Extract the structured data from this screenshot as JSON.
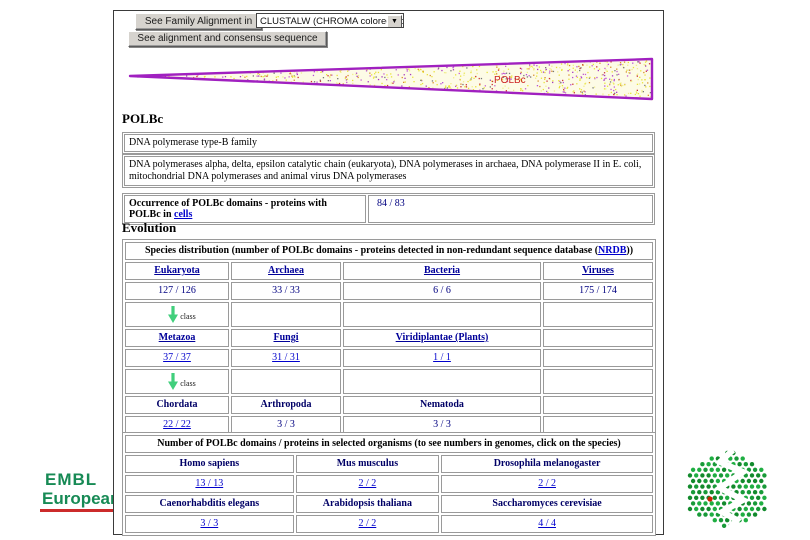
{
  "toolbar": {
    "alignment_button": "See Family Alignment in",
    "format_dropdown": "CLUSTALW (CHROMA colored) format",
    "consensus_button": "See alignment and consensus sequence"
  },
  "figure": {
    "domain_label": "POLBc"
  },
  "domain": {
    "title": "POLBc",
    "family": "DNA polymerase type-B family",
    "description": "DNA polymerases alpha, delta, epsilon catalytic chain (eukaryota), DNA polymerases in archaea, DNA polymerase II in E. coli, mitochondrial DNA polymerases and animal virus DNA polymerases"
  },
  "occurrence": {
    "label_prefix": "Occurrence of POLBc domains - proteins with POLBc in ",
    "label_link": "cells",
    "value": "84 / 83"
  },
  "evolution": {
    "heading": "Evolution",
    "species_table": {
      "caption_prefix": "Species distribution (number of POLBc domains - proteins detected in non-redundant sequence database (",
      "caption_link": "NRDB",
      "caption_suffix": "))",
      "arrow_label": "class",
      "kingdom_headers": [
        "Eukaryota",
        "Archaea",
        "Bacteria",
        "Viruses"
      ],
      "kingdom_values": [
        "127 / 126",
        "33 / 33",
        "6 / 6",
        "175 / 174"
      ],
      "group2_headers": [
        "Metazoa",
        "Fungi",
        "Viridiplantae (Plants)"
      ],
      "group2_values": [
        "37 / 37",
        "31 / 31",
        "1 / 1"
      ],
      "group3_headers": [
        "Chordata",
        "Arthropoda",
        "Nematoda"
      ],
      "group3_values": [
        "22 / 22",
        "3 / 3",
        "3 / 3"
      ]
    },
    "organisms_table": {
      "caption": "Number of POLBc domains / proteins in selected organisms (to see numbers in genomes, click on the species)",
      "row1_headers": [
        "Homo sapiens",
        "Mus musculus",
        "Drosophila melanogaster"
      ],
      "row1_values": [
        "13 / 13",
        "2 / 2",
        "2 / 2"
      ],
      "row2_headers": [
        "Caenorhabditis elegans",
        "Arabidopsis thaliana",
        "Saccharomyces cerevisiae"
      ],
      "row2_values": [
        "3 / 3",
        "2 / 2",
        "4 / 4"
      ]
    }
  },
  "footer": {
    "embl": "EMBL",
    "institute": "European B"
  }
}
